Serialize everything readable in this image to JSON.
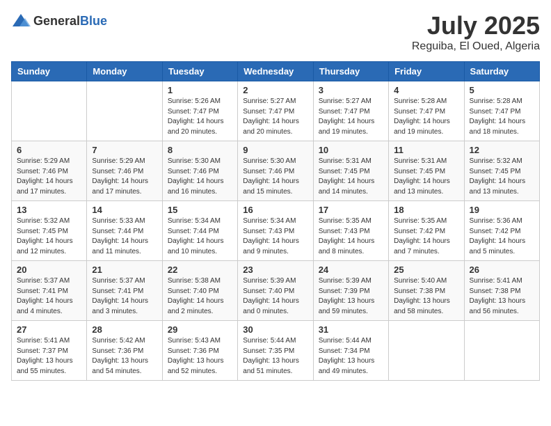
{
  "header": {
    "logo_general": "General",
    "logo_blue": "Blue",
    "month_year": "July 2025",
    "location": "Reguiba, El Oued, Algeria"
  },
  "weekdays": [
    "Sunday",
    "Monday",
    "Tuesday",
    "Wednesday",
    "Thursday",
    "Friday",
    "Saturday"
  ],
  "weeks": [
    [
      {
        "day": "",
        "info": ""
      },
      {
        "day": "",
        "info": ""
      },
      {
        "day": "1",
        "info": "Sunrise: 5:26 AM\nSunset: 7:47 PM\nDaylight: 14 hours and 20 minutes."
      },
      {
        "day": "2",
        "info": "Sunrise: 5:27 AM\nSunset: 7:47 PM\nDaylight: 14 hours and 20 minutes."
      },
      {
        "day": "3",
        "info": "Sunrise: 5:27 AM\nSunset: 7:47 PM\nDaylight: 14 hours and 19 minutes."
      },
      {
        "day": "4",
        "info": "Sunrise: 5:28 AM\nSunset: 7:47 PM\nDaylight: 14 hours and 19 minutes."
      },
      {
        "day": "5",
        "info": "Sunrise: 5:28 AM\nSunset: 7:47 PM\nDaylight: 14 hours and 18 minutes."
      }
    ],
    [
      {
        "day": "6",
        "info": "Sunrise: 5:29 AM\nSunset: 7:46 PM\nDaylight: 14 hours and 17 minutes."
      },
      {
        "day": "7",
        "info": "Sunrise: 5:29 AM\nSunset: 7:46 PM\nDaylight: 14 hours and 17 minutes."
      },
      {
        "day": "8",
        "info": "Sunrise: 5:30 AM\nSunset: 7:46 PM\nDaylight: 14 hours and 16 minutes."
      },
      {
        "day": "9",
        "info": "Sunrise: 5:30 AM\nSunset: 7:46 PM\nDaylight: 14 hours and 15 minutes."
      },
      {
        "day": "10",
        "info": "Sunrise: 5:31 AM\nSunset: 7:45 PM\nDaylight: 14 hours and 14 minutes."
      },
      {
        "day": "11",
        "info": "Sunrise: 5:31 AM\nSunset: 7:45 PM\nDaylight: 14 hours and 13 minutes."
      },
      {
        "day": "12",
        "info": "Sunrise: 5:32 AM\nSunset: 7:45 PM\nDaylight: 14 hours and 13 minutes."
      }
    ],
    [
      {
        "day": "13",
        "info": "Sunrise: 5:32 AM\nSunset: 7:45 PM\nDaylight: 14 hours and 12 minutes."
      },
      {
        "day": "14",
        "info": "Sunrise: 5:33 AM\nSunset: 7:44 PM\nDaylight: 14 hours and 11 minutes."
      },
      {
        "day": "15",
        "info": "Sunrise: 5:34 AM\nSunset: 7:44 PM\nDaylight: 14 hours and 10 minutes."
      },
      {
        "day": "16",
        "info": "Sunrise: 5:34 AM\nSunset: 7:43 PM\nDaylight: 14 hours and 9 minutes."
      },
      {
        "day": "17",
        "info": "Sunrise: 5:35 AM\nSunset: 7:43 PM\nDaylight: 14 hours and 8 minutes."
      },
      {
        "day": "18",
        "info": "Sunrise: 5:35 AM\nSunset: 7:42 PM\nDaylight: 14 hours and 7 minutes."
      },
      {
        "day": "19",
        "info": "Sunrise: 5:36 AM\nSunset: 7:42 PM\nDaylight: 14 hours and 5 minutes."
      }
    ],
    [
      {
        "day": "20",
        "info": "Sunrise: 5:37 AM\nSunset: 7:41 PM\nDaylight: 14 hours and 4 minutes."
      },
      {
        "day": "21",
        "info": "Sunrise: 5:37 AM\nSunset: 7:41 PM\nDaylight: 14 hours and 3 minutes."
      },
      {
        "day": "22",
        "info": "Sunrise: 5:38 AM\nSunset: 7:40 PM\nDaylight: 14 hours and 2 minutes."
      },
      {
        "day": "23",
        "info": "Sunrise: 5:39 AM\nSunset: 7:40 PM\nDaylight: 14 hours and 0 minutes."
      },
      {
        "day": "24",
        "info": "Sunrise: 5:39 AM\nSunset: 7:39 PM\nDaylight: 13 hours and 59 minutes."
      },
      {
        "day": "25",
        "info": "Sunrise: 5:40 AM\nSunset: 7:38 PM\nDaylight: 13 hours and 58 minutes."
      },
      {
        "day": "26",
        "info": "Sunrise: 5:41 AM\nSunset: 7:38 PM\nDaylight: 13 hours and 56 minutes."
      }
    ],
    [
      {
        "day": "27",
        "info": "Sunrise: 5:41 AM\nSunset: 7:37 PM\nDaylight: 13 hours and 55 minutes."
      },
      {
        "day": "28",
        "info": "Sunrise: 5:42 AM\nSunset: 7:36 PM\nDaylight: 13 hours and 54 minutes."
      },
      {
        "day": "29",
        "info": "Sunrise: 5:43 AM\nSunset: 7:36 PM\nDaylight: 13 hours and 52 minutes."
      },
      {
        "day": "30",
        "info": "Sunrise: 5:44 AM\nSunset: 7:35 PM\nDaylight: 13 hours and 51 minutes."
      },
      {
        "day": "31",
        "info": "Sunrise: 5:44 AM\nSunset: 7:34 PM\nDaylight: 13 hours and 49 minutes."
      },
      {
        "day": "",
        "info": ""
      },
      {
        "day": "",
        "info": ""
      }
    ]
  ]
}
